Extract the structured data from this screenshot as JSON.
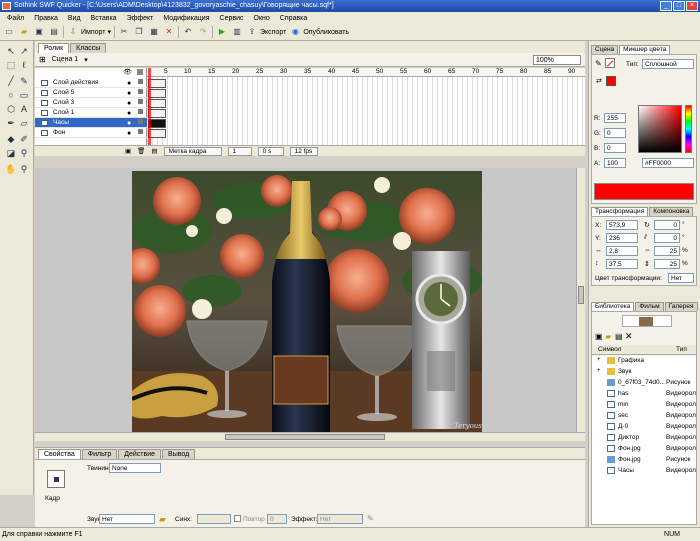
{
  "window": {
    "title": "Sothink SWF Quicker - [C:\\Users\\ADM\\Desktop\\4123832_govoryaschie_chasuy\\Говорящие часы.sqf*]",
    "controls": [
      "_",
      "□",
      "×"
    ]
  },
  "menu": [
    "Файл",
    "Правка",
    "Вид",
    "Вставка",
    "Эффект",
    "Модификация",
    "Сервис",
    "Окно",
    "Справка"
  ],
  "toolbar": {
    "import_label": "Импорт",
    "export_label": "Экспорт",
    "publish_label": "Опубликовать"
  },
  "movie": {
    "tabs": [
      "Ролик",
      "Классы"
    ],
    "scene": "Сцена 1",
    "zoom": "100%"
  },
  "timeline": {
    "ruler": [
      "5",
      "10",
      "15",
      "20",
      "25",
      "30",
      "35",
      "40",
      "45",
      "50",
      "55",
      "60",
      "65",
      "70",
      "75",
      "80",
      "85",
      "90"
    ],
    "layers": [
      {
        "name": "Слой действия",
        "selected": false
      },
      {
        "name": "Слой 5",
        "selected": false
      },
      {
        "name": "Слой 3",
        "selected": false
      },
      {
        "name": "Слой 1",
        "selected": false
      },
      {
        "name": "Часы",
        "selected": true
      },
      {
        "name": "Фон",
        "selected": false
      }
    ],
    "footer": {
      "frame_label": "Метка кадра",
      "frame": "1",
      "time": "0 s",
      "fps": "12 fps"
    }
  },
  "stage": {
    "watermark": "Teryoush"
  },
  "properties": {
    "tabs": [
      "Свойства",
      "Фильтр",
      "Действие",
      "Вывод"
    ],
    "frame_label": "Кадр",
    "tween_label": "Твининг:",
    "tween_value": "None",
    "sound_label": "Звук:",
    "sound_value": "Нет",
    "sync_label": "Синх:",
    "repeat_label": "Повтор",
    "repeat_value": "0",
    "effect_label": "Эффект:",
    "effect_value": "Нет"
  },
  "color_panel": {
    "tabs": [
      "Сцена",
      "Микшер цвета"
    ],
    "type_label": "Тип:",
    "type_value": "Сплошной",
    "r_label": "R:",
    "r": "255",
    "g_label": "G:",
    "g": "0",
    "b_label": "B:",
    "b": "0",
    "a_label": "A:",
    "a": "100",
    "hex": "#FF0000",
    "swatch": "#ff0000"
  },
  "transform_panel": {
    "tabs": [
      "Трансформация",
      "Компоновка"
    ],
    "x_label": "X:",
    "x": "573,9",
    "y_label": "Y:",
    "y": "236",
    "w": "2,8",
    "h": "37,5",
    "rot1": "0",
    "rot1_unit": "°",
    "rot2": "0",
    "rot2_unit": "°",
    "scale1": "25",
    "scale1_unit": "%",
    "scale2": "25",
    "scale2_unit": "%",
    "color_label": "Цвет трансформации:",
    "color_value": "Нет"
  },
  "library_panel": {
    "tabs": [
      "Библиотека",
      "Фильм",
      "Галерея"
    ],
    "col_symbol": "Символ",
    "col_type": "Тип",
    "items": [
      {
        "name": "Графика",
        "type": "",
        "kind": "folder"
      },
      {
        "name": "Звук",
        "type": "",
        "kind": "folder"
      },
      {
        "name": "0_67f03_74d0...",
        "type": "Рисунок",
        "kind": "image"
      },
      {
        "name": "has",
        "type": "Видеорол...",
        "kind": "clip"
      },
      {
        "name": "min",
        "type": "Видеорол...",
        "kind": "clip"
      },
      {
        "name": "sec",
        "type": "Видеорол...",
        "kind": "clip"
      },
      {
        "name": "Д-0",
        "type": "Видеорол...",
        "kind": "clip"
      },
      {
        "name": "Диктор",
        "type": "Видеорол...",
        "kind": "clip"
      },
      {
        "name": "Фон.jpg",
        "type": "Видеорол...",
        "kind": "clip"
      },
      {
        "name": "Фон.jpg",
        "type": "Рисунок",
        "kind": "image"
      },
      {
        "name": "Часы",
        "type": "Видеорол...",
        "kind": "clip"
      }
    ]
  },
  "status": {
    "help": "Для справки нажмите F1",
    "num": "NUM"
  }
}
